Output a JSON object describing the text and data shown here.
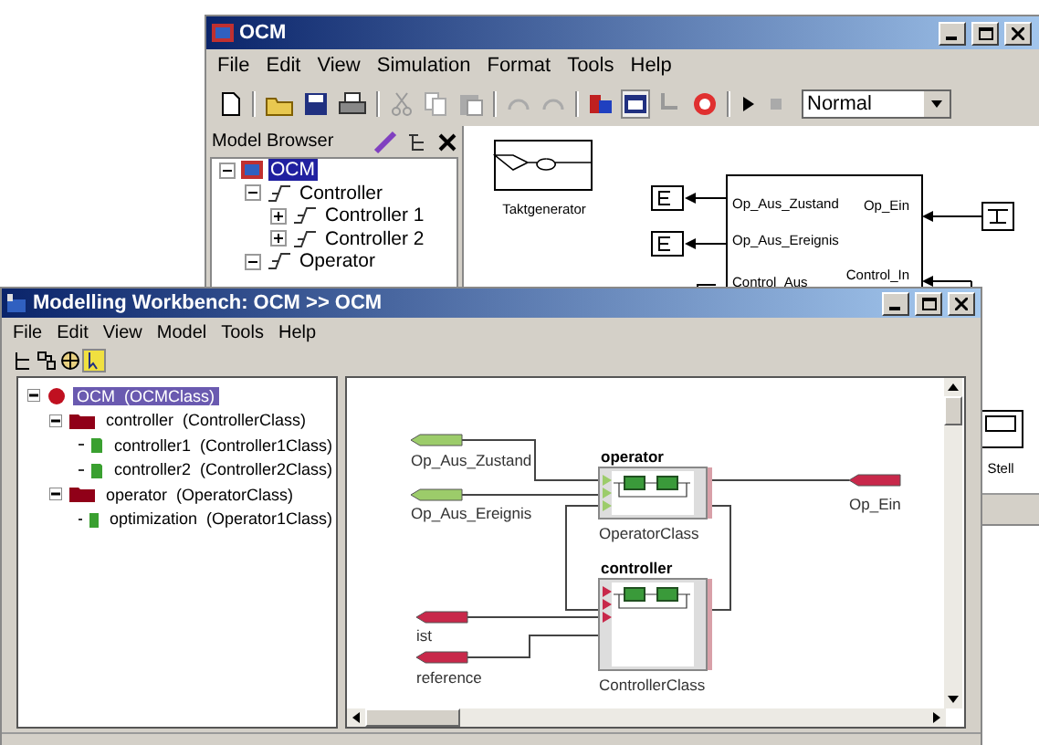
{
  "back_window": {
    "title": "OCM",
    "menu": [
      "File",
      "Edit",
      "View",
      "Simulation",
      "Format",
      "Tools",
      "Help"
    ],
    "mode_select": {
      "value": "Normal"
    },
    "model_browser": {
      "title": "Model Browser",
      "tree": [
        {
          "label": "OCM",
          "selected": true,
          "expanded": true,
          "children": [
            {
              "label": "Controller",
              "selected": false,
              "expanded": true,
              "children": [
                {
                  "label": "Controller 1",
                  "selected": false,
                  "expanded": false
                },
                {
                  "label": "Controller 2",
                  "selected": false,
                  "expanded": false
                }
              ]
            },
            {
              "label": "Operator",
              "selected": false,
              "expanded": true
            }
          ]
        }
      ]
    },
    "canvas": {
      "clock_block": {
        "label": "Taktgenerator"
      },
      "subsystem": {
        "left_ports": [
          "Op_Aus_Zustand",
          "Op_Aus_Ereignis",
          "Control_Aus"
        ],
        "right_ports": [
          "Op_Ein",
          "Control_In"
        ]
      },
      "side_block": {
        "label": "Stell"
      }
    }
  },
  "front_window": {
    "title": "Modelling Workbench: OCM >> OCM",
    "menu": [
      "File",
      "Edit",
      "View",
      "Model",
      "Tools",
      "Help"
    ],
    "tree": [
      {
        "kind": "root",
        "name": "OCM",
        "class": "(OCMClass)",
        "selected": true,
        "expanded": true,
        "children": [
          {
            "kind": "group",
            "name": "controller",
            "class": "(ControllerClass)",
            "selected": false,
            "expanded": true,
            "children": [
              {
                "kind": "leaf",
                "name": "controller1",
                "class": "(Controller1Class)",
                "selected": false
              },
              {
                "kind": "leaf",
                "name": "controller2",
                "class": "(Controller2Class)",
                "selected": false
              }
            ]
          },
          {
            "kind": "group",
            "name": "operator",
            "class": "(OperatorClass)",
            "selected": false,
            "expanded": true,
            "children": [
              {
                "kind": "leaf",
                "name": "optimization",
                "class": "(Operator1Class)",
                "selected": false
              }
            ]
          }
        ]
      }
    ],
    "diagram": {
      "ports": [
        {
          "name": "Op_Aus_Zustand",
          "color": "#9ccc6a"
        },
        {
          "name": "Op_Aus_Ereignis",
          "color": "#9ccc6a"
        },
        {
          "name": "ist",
          "color": "#c8284a"
        },
        {
          "name": "reference",
          "color": "#c8284a"
        },
        {
          "name": "Op_Ein",
          "color": "#c8284a"
        }
      ],
      "blocks": [
        {
          "title": "operator",
          "class": "OperatorClass"
        },
        {
          "title": "controller",
          "class": "ControllerClass"
        }
      ]
    }
  }
}
